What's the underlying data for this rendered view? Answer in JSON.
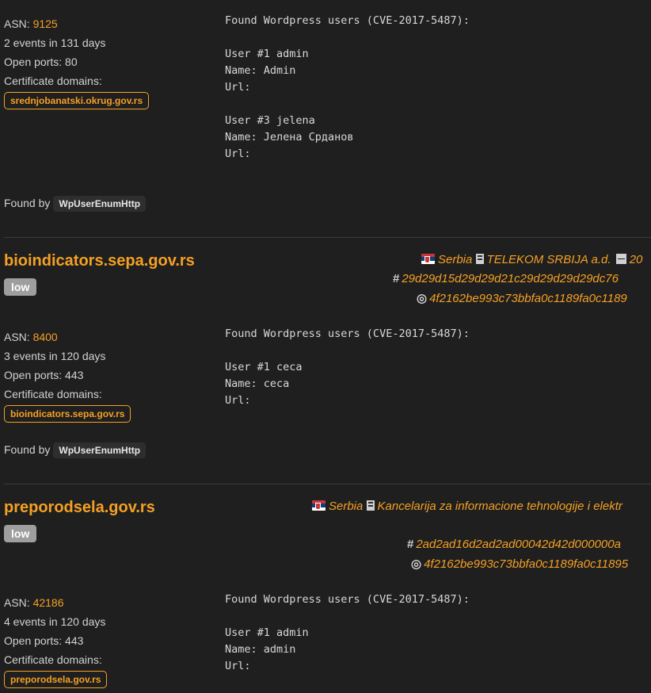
{
  "found_by_label": "Found by",
  "asn_label": "ASN:",
  "open_ports_label": "Open ports:",
  "cert_domains_label": "Certificate domains:",
  "records": [
    {
      "asn": "9125",
      "events": "2 events in 131 days",
      "open_ports": "80",
      "cert_domain": "srednjobanatski.okrug.gov.rs",
      "output": "Found Wordpress users (CVE-2017-5487):\n\nUser #1 admin\nName: Admin\nUrl:\n\nUser #3 jelena\nName: Јелена Срданов\nUrl:",
      "found_by": "WpUserEnumHttp"
    },
    {
      "host": "bioindicators.sepa.gov.rs",
      "severity": "low",
      "country": "Serbia",
      "org": "TELEKOM SRBIJA a.d.",
      "date": "20",
      "hash": "29d29d15d29d29d21c29d29d29d29dc76",
      "fingerprint": "4f2162be993c73bbfa0c1189fa0c1189",
      "asn": "8400",
      "events": "3 events in 120 days",
      "open_ports": "443",
      "cert_domain": "bioindicators.sepa.gov.rs",
      "output": "Found Wordpress users (CVE-2017-5487):\n\nUser #1 ceca\nName: ceca\nUrl:",
      "found_by": "WpUserEnumHttp"
    },
    {
      "host": "preporodsela.gov.rs",
      "severity": "low",
      "country": "Serbia",
      "org": "Kancelarija za informacione tehnologije i elektr",
      "hash": "2ad2ad16d2ad2ad00042d42d000000a",
      "fingerprint": "4f2162be993c73bbfa0c1189fa0c11895",
      "asn": "42186",
      "events": "4 events in 120 days",
      "open_ports": "443",
      "cert_domain": "preporodsela.gov.rs",
      "output": "Found Wordpress users (CVE-2017-5487):\n\nUser #1 admin\nName: admin\nUrl:"
    }
  ]
}
